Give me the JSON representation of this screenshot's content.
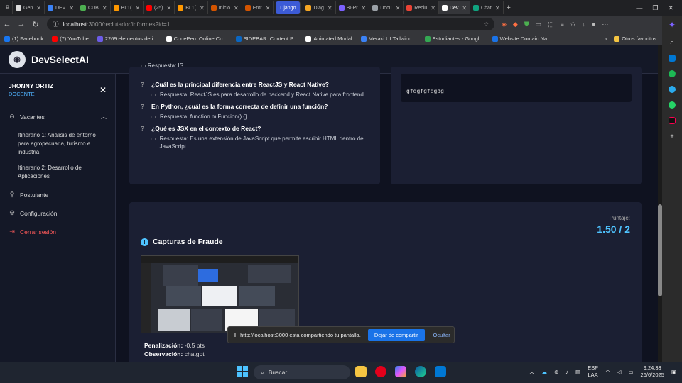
{
  "browser": {
    "tabs": [
      {
        "label": "Gen",
        "color": "#ddd"
      },
      {
        "label": "DEV",
        "color": "#3b82f6"
      },
      {
        "label": "CUB",
        "color": "#4caf50"
      },
      {
        "label": "BI 1(",
        "color": "#ff9800"
      },
      {
        "label": "(25)",
        "color": "#ff0000"
      },
      {
        "label": "BI 1(",
        "color": "#ff9800"
      },
      {
        "label": "Inicio",
        "color": "#d35400"
      },
      {
        "label": "Entr",
        "color": "#d35400"
      },
      {
        "label": "Django",
        "color": "#3c5bd6",
        "group": true
      },
      {
        "label": "Diag",
        "color": "#f5a623"
      },
      {
        "label": "BI-Pr",
        "color": "#7b61ff"
      },
      {
        "label": "Docu",
        "color": "#9aa0a6"
      },
      {
        "label": "Reclu",
        "color": "#ea4335"
      },
      {
        "label": "Dev",
        "color": "#ffffff",
        "active": true
      },
      {
        "label": "Chat",
        "color": "#10a37f"
      }
    ],
    "url_host": "localhost",
    "url_path": ":3000/reclutador/informes?id=1",
    "bookmarks": [
      {
        "label": "(1) Facebook",
        "color": "#1877f2"
      },
      {
        "label": "(7) YouTube",
        "color": "#ff0000"
      },
      {
        "label": "2269 elementos de i...",
        "color": "#6c5ce7"
      },
      {
        "label": "CodePen: Online Co...",
        "color": "#ffffff"
      },
      {
        "label": "SIDEBAR: Content P...",
        "color": "#0a66c2"
      },
      {
        "label": "Animated Modal",
        "color": "#ffffff"
      },
      {
        "label": "Meraki UI Tailwind...",
        "color": "#3b82f6"
      },
      {
        "label": "Estudiantes - Googl...",
        "color": "#34a853"
      },
      {
        "label": "Website Domain Na...",
        "color": "#1a73e8"
      }
    ],
    "other_favorites": "Otros favoritos"
  },
  "app": {
    "brand": "DevSelectAI",
    "user_name": "JHONNY ORTIZ",
    "user_role": "DOCENTE",
    "menu": {
      "vacantes": "Vacantes",
      "itinerario1": "Itinerario 1: Análisis de entorno para agropecuaria, turismo e industria",
      "itinerario2": "Itinerario 2: Desarrollo de Aplicaciones",
      "postulante": "Postulante",
      "configuracion": "Configuración",
      "cerrar": "Cerrar sesión"
    },
    "qa_clipped": "Respuesta: IS",
    "questions": [
      {
        "q": "¿Cuál es la principal diferencia entre ReactJS y React Native?",
        "a": "Respuesta: ReactJS es para desarrollo de backend y React Native para frontend"
      },
      {
        "q": "En Python, ¿cuál es la forma correcta de definir una función?",
        "a": "Respuesta: function miFuncion() {}"
      },
      {
        "q": "¿Qué es JSX en el contexto de React?",
        "a": "Respuesta: Es una extensión de JavaScript que permite escribir HTML dentro de JavaScript"
      }
    ],
    "code_text": "gfdgfgfdgdg",
    "score_label": "Puntaje:",
    "score_value": "1.50 / 2",
    "fraud_title": "Capturas de Fraude",
    "penalty_label": "Penalización:",
    "penalty_value": "-0.5 pts",
    "observation_label": "Observación:",
    "observation_value": "chatgpt"
  },
  "share": {
    "message": "http://localhost:3000 está compartiendo tu pantalla.",
    "stop": "Dejar de compartir",
    "hide": "Ocultar"
  },
  "taskbar": {
    "search": "Buscar",
    "lang1": "ESP",
    "lang2": "LAA",
    "time": "9:24:33",
    "date": "26/6/2025"
  }
}
